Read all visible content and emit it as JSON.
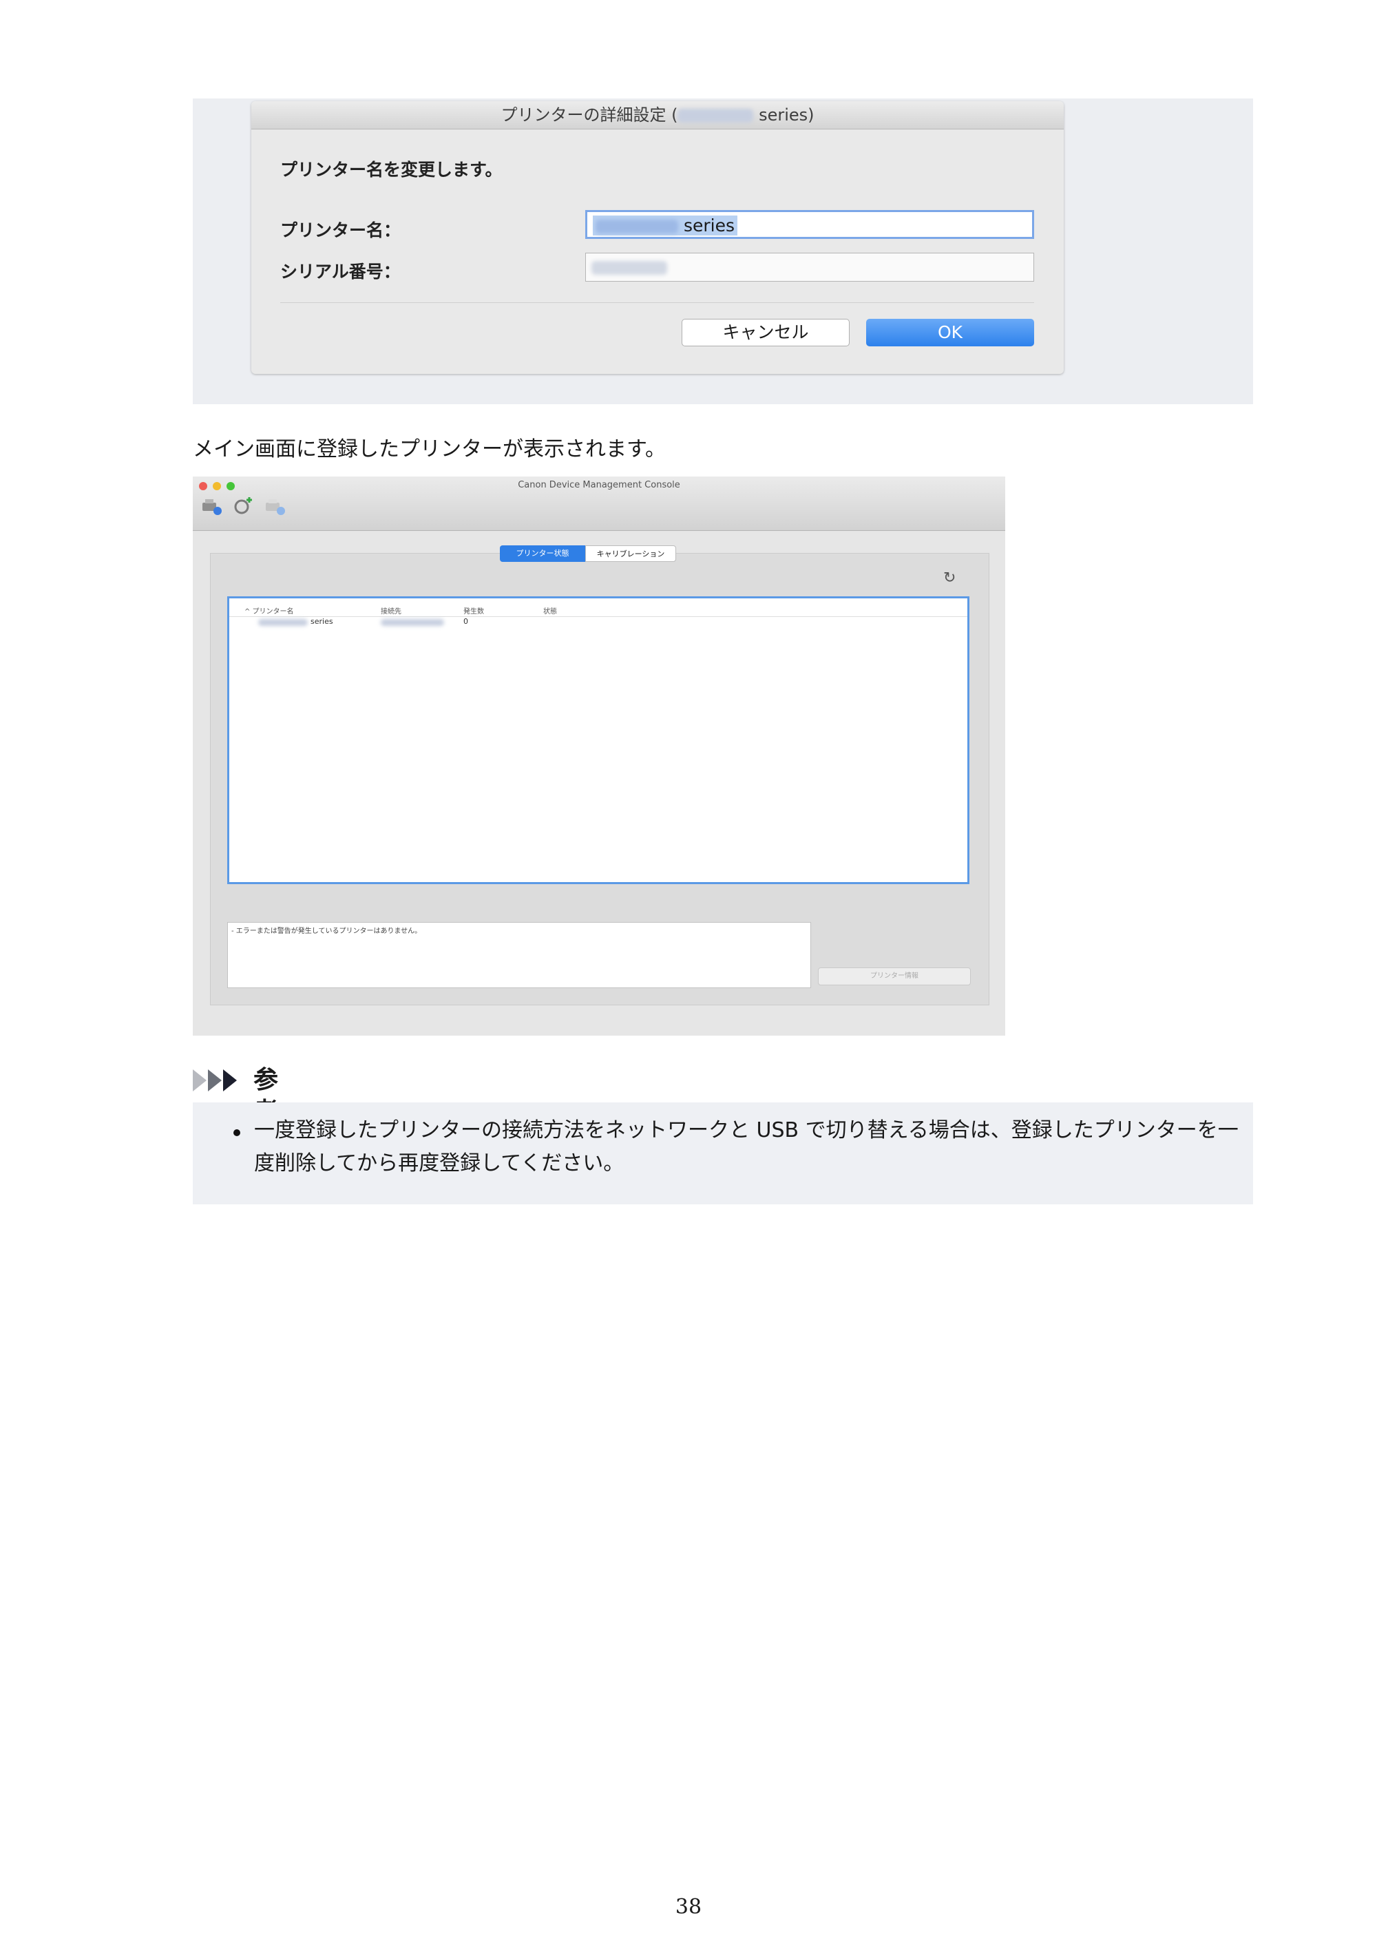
{
  "dialog": {
    "title_prefix": "プリンターの詳細設定 (",
    "title_suffix": " series)",
    "heading": "プリンター名を変更します。",
    "printer_name_label": "プリンター名：",
    "printer_name_suffix": "series",
    "serial_label": "シリアル番号：",
    "cancel_label": "キャンセル",
    "ok_label": "OK"
  },
  "caption": "メイン画面に登録したプリンターが表示されます。",
  "main_window": {
    "title": "Canon Device Management Console",
    "tabs": [
      "プリンター状態",
      "キャリブレーション"
    ],
    "columns": [
      "^ プリンター名",
      "接続先",
      "発生数",
      "状態"
    ],
    "row": {
      "name_suffix": "series",
      "count": "0"
    },
    "message": "- エラーまたは警告が発生しているプリンターはありません。",
    "info_button": "プリンター情報"
  },
  "note": {
    "title": "参考",
    "items": [
      "一度登録したプリンターの接続方法をネットワークと USB で切り替える場合は、登録したプリンターを一度削除してから再度登録してください。"
    ]
  },
  "page_number": "38"
}
